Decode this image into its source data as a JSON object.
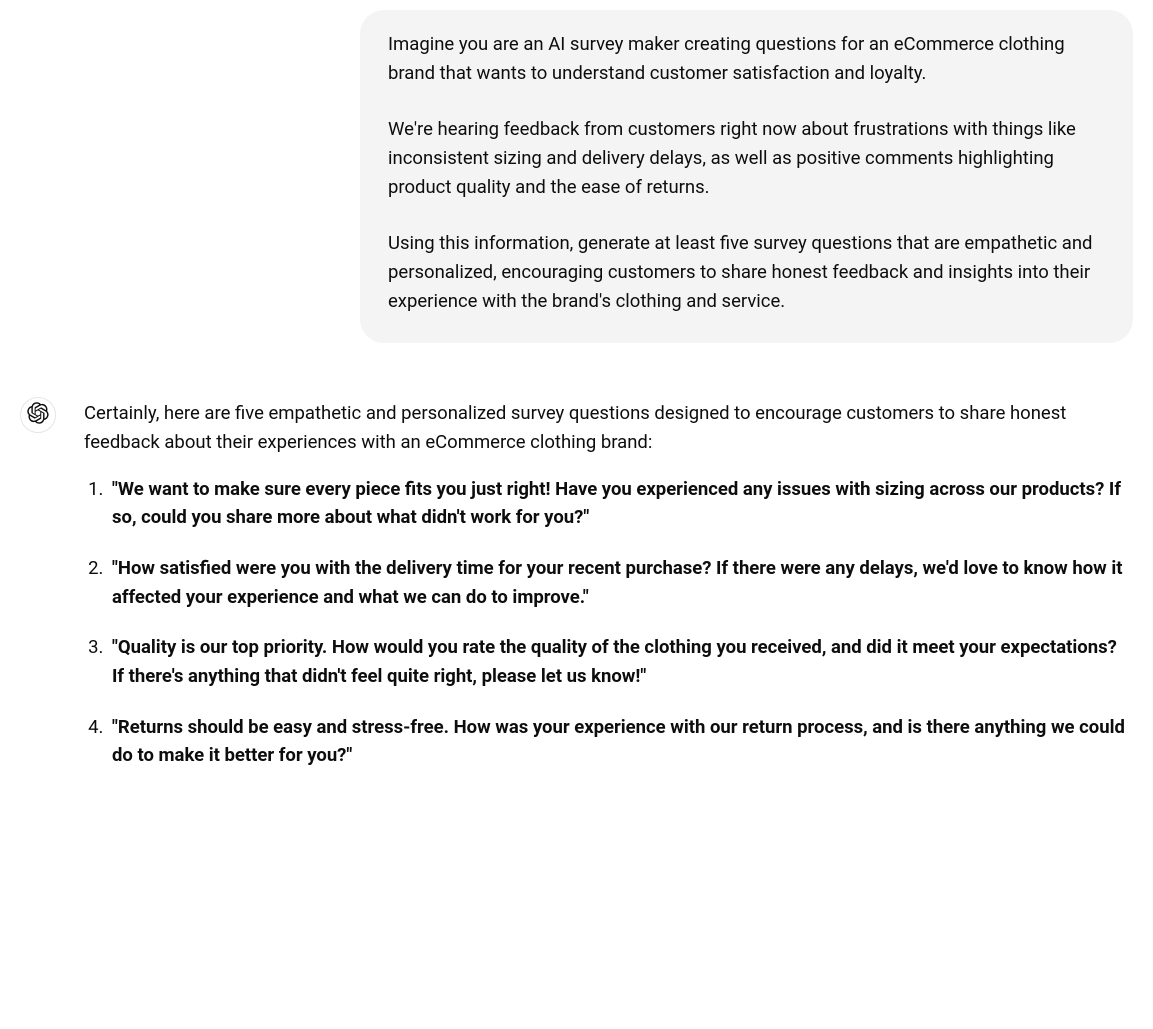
{
  "user_message": {
    "p1": "Imagine you are an AI survey maker creating questions for an eCommerce clothing brand that wants to understand customer satisfaction and loyalty.",
    "p2": "We're hearing feedback from customers right now about frustrations with things like inconsistent sizing and delivery delays, as well as positive comments highlighting product quality and the ease of returns.",
    "p3": "Using this information, generate at least five survey questions that are empathetic and personalized, encouraging customers to share honest feedback and insights into their experience with the brand's clothing and service."
  },
  "assistant": {
    "intro": "Certainly, here are five empathetic and personalized survey questions designed to encourage customers to share honest feedback about their experiences with an eCommerce clothing brand:",
    "items": [
      "\"We want to make sure every piece fits you just right! Have you experienced any issues with sizing across our products? If so, could you share more about what didn't work for you?\"",
      "\"How satisfied were you with the delivery time for your recent purchase? If there were any delays, we'd love to know how it affected your experience and what we can do to improve.\"",
      "\"Quality is our top priority. How would you rate the quality of the clothing you received, and did it meet your expectations? If there's anything that didn't feel quite right, please let us know!\"",
      "\"Returns should be easy and stress-free. How was your experience with our return process, and is there anything we could do to make it better for you?\""
    ]
  }
}
